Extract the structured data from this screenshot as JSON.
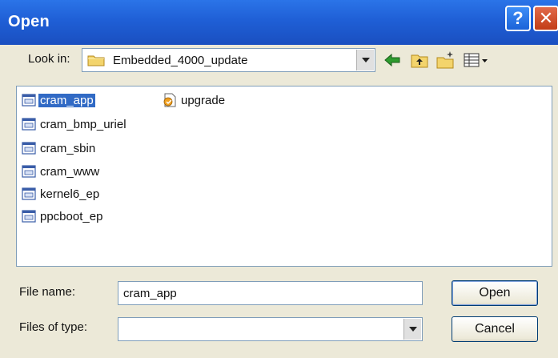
{
  "window": {
    "title": "Open",
    "help_button": "?",
    "close_button": "✕"
  },
  "toolbar": {
    "look_in_label": "Look in:",
    "look_in_value": "Embedded_4000_update",
    "back_icon": "back-arrow-icon",
    "up_icon": "up-folder-icon",
    "new_folder_icon": "new-folder-icon",
    "views_icon": "views-menu-icon"
  },
  "files": [
    {
      "name": "cram_app",
      "icon": "generic-file-icon",
      "selected": true
    },
    {
      "name": "cram_bmp_uriel",
      "icon": "generic-file-icon"
    },
    {
      "name": "cram_sbin",
      "icon": "generic-file-icon"
    },
    {
      "name": "cram_www",
      "icon": "generic-file-icon"
    },
    {
      "name": "kernel6_ep",
      "icon": "generic-file-icon"
    },
    {
      "name": "ppcboot_ep",
      "icon": "generic-file-icon"
    },
    {
      "name": "upgrade",
      "icon": "script-file-icon"
    }
  ],
  "file_name": {
    "label": "File name:",
    "value": "cram_app"
  },
  "file_type": {
    "label": "Files of type:",
    "value": ""
  },
  "buttons": {
    "open": "Open",
    "cancel": "Cancel"
  },
  "colors": {
    "titlebar": "#1f5fd6",
    "selection": "#316ac5",
    "dialog_bg": "#ece9d8"
  }
}
